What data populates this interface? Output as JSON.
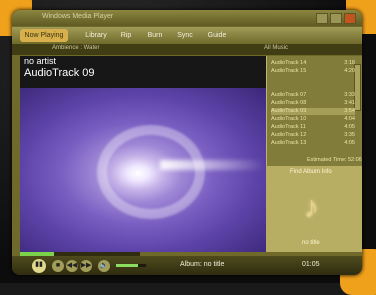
{
  "app_title": "Windows Media Player",
  "tabs": [
    {
      "label": "Now Playing"
    },
    {
      "label": "Library"
    },
    {
      "label": "Rip"
    },
    {
      "label": "Burn"
    },
    {
      "label": "Sync"
    },
    {
      "label": "Guide"
    }
  ],
  "subbar": {
    "left_label": "Ambience : Water",
    "right_dropdown": "All Music"
  },
  "now_playing": {
    "artist": "no artist",
    "title": "AudioTrack 09"
  },
  "playlist": {
    "items": [
      {
        "name": "AudioTrack 14",
        "dur": "3:18"
      },
      {
        "name": "AudioTrack 15",
        "dur": "4:20"
      },
      {
        "name": "AudioTrack 07",
        "dur": "3:33"
      },
      {
        "name": "AudioTrack 08",
        "dur": "3:41"
      },
      {
        "name": "AudioTrack 09",
        "dur": "3:54"
      },
      {
        "name": "AudioTrack 10",
        "dur": "4:04"
      },
      {
        "name": "AudioTrack 11",
        "dur": "4:05"
      },
      {
        "name": "AudioTrack 12",
        "dur": "3:35"
      },
      {
        "name": "AudioTrack 13",
        "dur": "4:05"
      }
    ],
    "total": "Estimated Time: 52:06"
  },
  "album_panel": {
    "title": "Find Album Info",
    "caption": "no title"
  },
  "transport": {
    "album_label": "Album: no title",
    "time": "01:05",
    "seek_progress": 0.28,
    "volume_level": 0.72
  },
  "colors": {
    "accent": "#d7b04b",
    "frame": "#f0a11b"
  }
}
